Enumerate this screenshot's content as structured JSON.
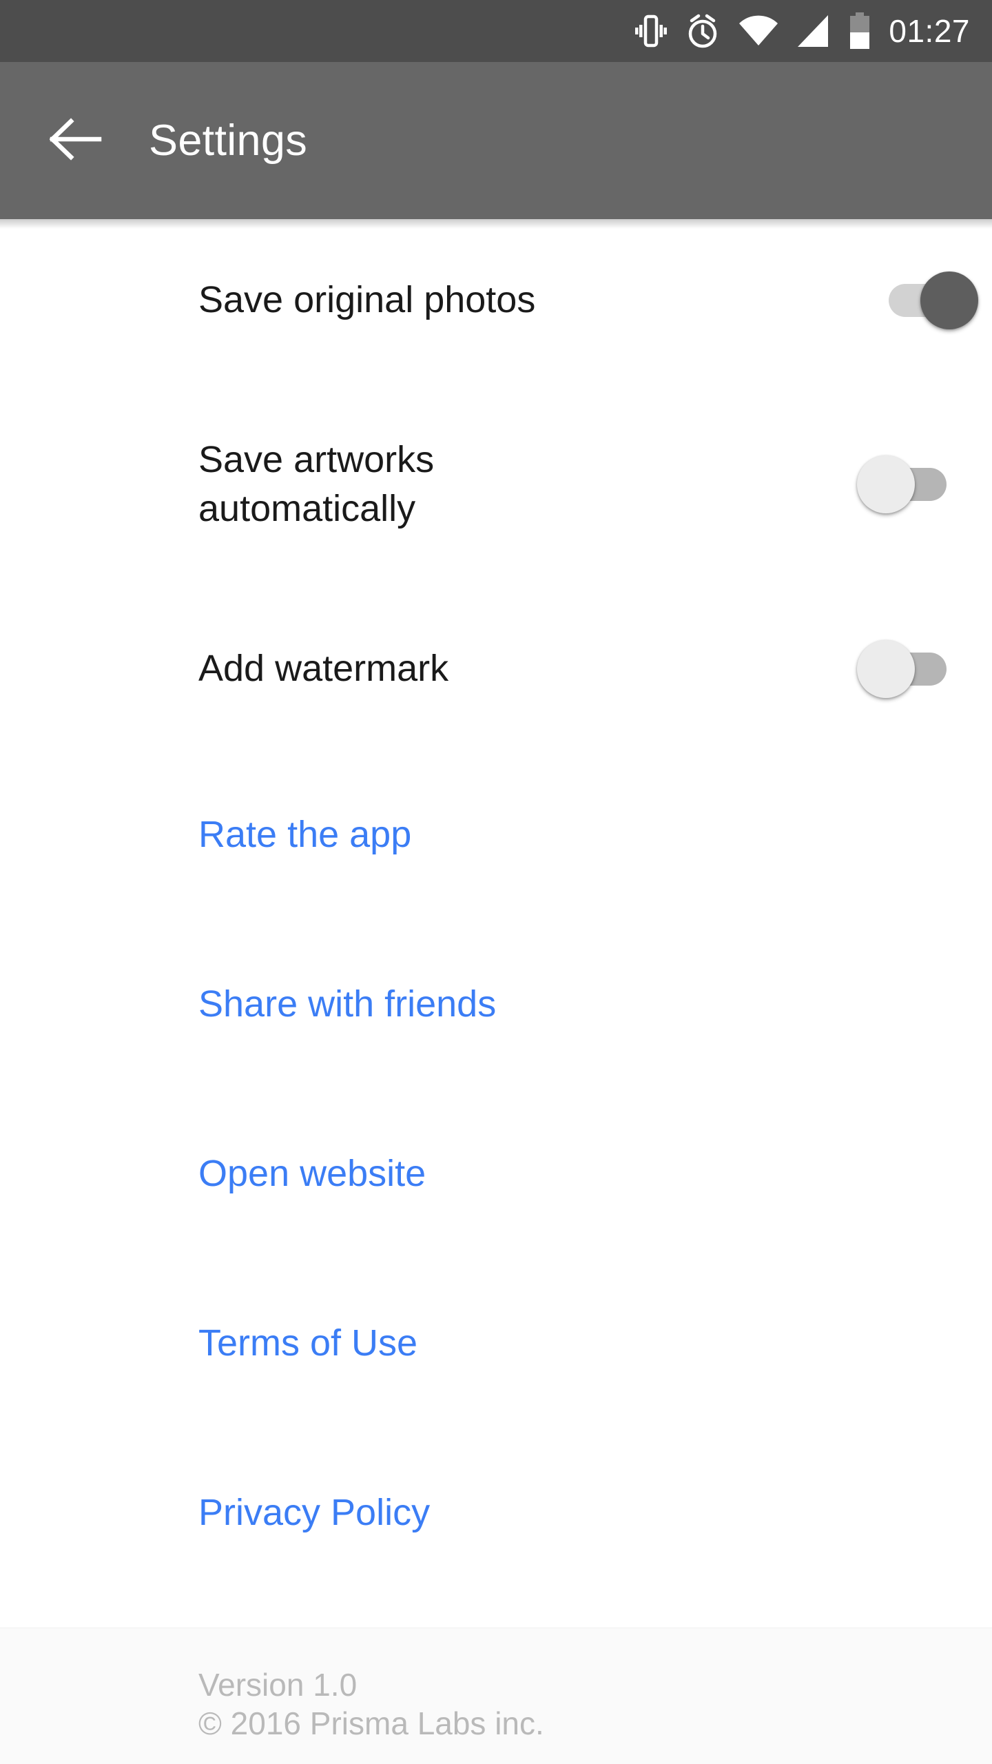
{
  "status_bar": {
    "background": "#4d4d4d",
    "time": "01:27",
    "icons": [
      "vibrate-icon",
      "alarm-icon",
      "wifi-icon",
      "cellular-signal-icon",
      "battery-icon"
    ]
  },
  "app_bar": {
    "background": "#676767",
    "title": "Settings",
    "back_icon": "arrow-back-icon"
  },
  "toggles": [
    {
      "label": "Save original photos",
      "state": "on"
    },
    {
      "label": "Save artworks\nautomatically",
      "state": "off"
    },
    {
      "label": "Add watermark",
      "state": "off"
    }
  ],
  "links": [
    {
      "label": "Rate the app"
    },
    {
      "label": "Share with friends"
    },
    {
      "label": "Open website"
    },
    {
      "label": "Terms of Use"
    },
    {
      "label": "Privacy Policy"
    }
  ],
  "footer": {
    "version": "Version 1.0",
    "copyright": "© 2016 Prisma Labs inc."
  },
  "colors": {
    "link_blue": "#3b7df5",
    "text_primary": "#1a1a1a",
    "footer_text": "#b9b9b9",
    "switch_on_track": "#d2d2d2",
    "switch_on_thumb": "#5e5e5e",
    "switch_off_track": "#b5b5b5",
    "switch_off_thumb": "#ececec"
  }
}
